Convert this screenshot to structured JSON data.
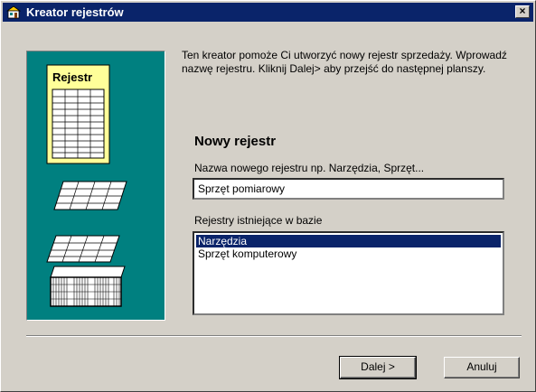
{
  "window": {
    "title": "Kreator rejestrów",
    "close_symbol": "×"
  },
  "sidebar": {
    "illustration_label": "Rejestr"
  },
  "main": {
    "intro": "Ten kreator pomoże Ci utworzyć nowy rejestr sprzedaży. Wprowadź nazwę rejestru. Kliknij Dalej> aby przejść do następnej planszy.",
    "heading": "Nowy rejestr",
    "name_label": "Nazwa nowego rejestru np. Narzędzia, Sprzęt...",
    "name_value": "Sprzęt pomiarowy",
    "existing_label": "Rejestry istniejące w bazie",
    "existing_items": [
      "Narzędzia",
      "Sprzęt komputerowy"
    ],
    "selected_index": 0
  },
  "buttons": {
    "next": "Dalej >",
    "cancel": "Anuluj"
  },
  "colors": {
    "title_bar": "#0a246a",
    "panel": "#008080",
    "face": "#d4d0c8",
    "selection": "#0a246a",
    "illustration_card": "#ffff99"
  }
}
